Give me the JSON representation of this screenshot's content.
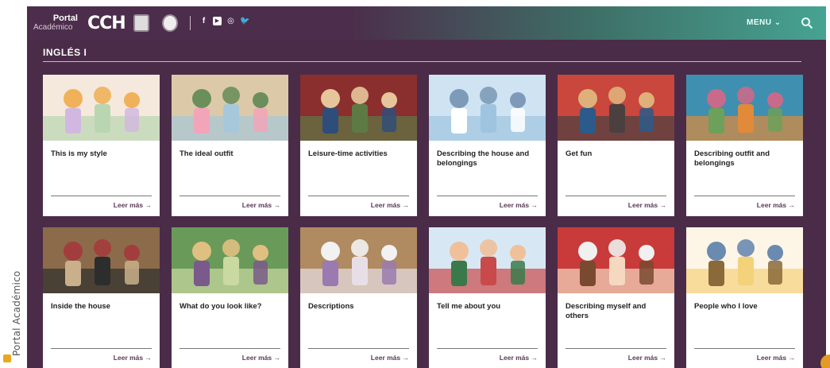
{
  "watermark": {
    "text": "Portal Académico"
  },
  "header": {
    "brand_line1": "Portal",
    "brand_line2": "Académico",
    "logo_text": "CCH",
    "social": [
      "f",
      "▶",
      "◎",
      "🐦"
    ],
    "menu_label": "MENU ⌄"
  },
  "section": {
    "title": "INGLÉS I"
  },
  "colors": {
    "background": "#4a2c48",
    "accent": "#46a392",
    "card": "#ffffff"
  },
  "cards": [
    {
      "title": "This is my style",
      "link": "Leer más →",
      "palette": [
        "#f5e9dd",
        "#b9d6b0",
        "#d2b8e0",
        "#f0b15a"
      ]
    },
    {
      "title": "The ideal outfit",
      "link": "Leer más →",
      "palette": [
        "#dcc9a8",
        "#a7c8da",
        "#f2a4b9",
        "#6b8f5a"
      ]
    },
    {
      "title": "Leisure-time activities",
      "link": "Leer más →",
      "palette": [
        "#8b2e2e",
        "#5d7a45",
        "#2f4d7a",
        "#e7c59a"
      ]
    },
    {
      "title": "Describing the house and belongings",
      "link": "Leer más →",
      "palette": [
        "#cfe3f2",
        "#9ec4e0",
        "#ffffff",
        "#7d9bb8"
      ]
    },
    {
      "title": "Get fun",
      "link": "Leer más →",
      "palette": [
        "#c9473c",
        "#4a4040",
        "#2c5a8a",
        "#e0b07a"
      ]
    },
    {
      "title": "Describing outfit and belongings",
      "link": "Leer más →",
      "palette": [
        "#3f8fb0",
        "#e08a3a",
        "#6da05a",
        "#c96a8a"
      ]
    },
    {
      "title": "Inside the house",
      "link": "Leer más →",
      "palette": [
        "#8b6b4a",
        "#2d2d2d",
        "#c9b08a",
        "#a33c3c"
      ]
    },
    {
      "title": "What do you look like?",
      "link": "Leer más →",
      "palette": [
        "#6a9a5a",
        "#c9d9a0",
        "#7a5a8a",
        "#e0c080"
      ]
    },
    {
      "title": "Descriptions",
      "link": "Leer más →",
      "palette": [
        "#b08a60",
        "#e8dfe6",
        "#9a7ab0",
        "#f2f2f2"
      ]
    },
    {
      "title": "Tell me about you",
      "link": "Leer más →",
      "palette": [
        "#d7e8f4",
        "#c94a4a",
        "#3a7a4a",
        "#f0c09a"
      ]
    },
    {
      "title": "Describing myself and others",
      "link": "Leer más →",
      "palette": [
        "#c93a3a",
        "#f4d8c0",
        "#7a4a30",
        "#f0f0f0"
      ]
    },
    {
      "title": "People who I love",
      "link": "Leer más →",
      "palette": [
        "#fdf5e6",
        "#f3d27a",
        "#8a6a3a",
        "#6a8ab0"
      ]
    }
  ]
}
